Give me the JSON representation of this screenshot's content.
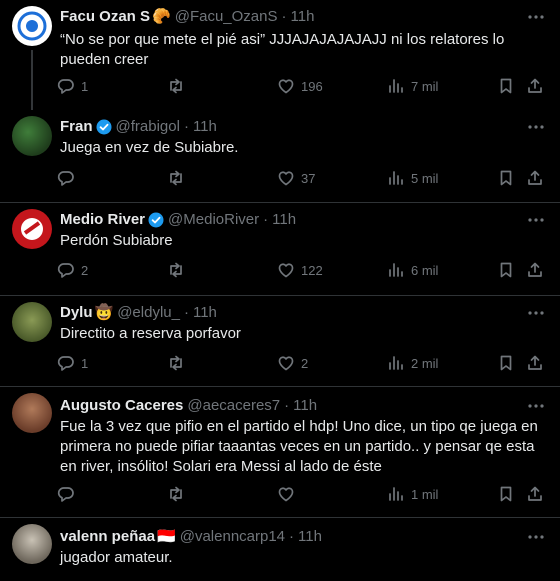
{
  "tweets": [
    {
      "name": "Facu Ozan S",
      "emoji": "🥐",
      "handle": "@Facu_OzanS",
      "time": "11h",
      "verified": false,
      "text": "“No se por que mete el pié asi” JJJAJAJAJAJAJJ ni los relatores lo pueden creer",
      "replies": "1",
      "retweets": "",
      "likes": "196",
      "views": "7 mil"
    },
    {
      "name": "Fran",
      "emoji": "",
      "handle": "@frabigol",
      "time": "11h",
      "verified": true,
      "text": "Juega en vez de Subiabre.",
      "replies": "",
      "retweets": "",
      "likes": "37",
      "views": "5 mil"
    },
    {
      "name": "Medio River",
      "emoji": "",
      "handle": "@MedioRiver",
      "time": "11h",
      "verified": true,
      "text": "Perdón Subiabre",
      "replies": "2",
      "retweets": "",
      "likes": "122",
      "views": "6 mil"
    },
    {
      "name": "Dylu",
      "emoji": "🤠",
      "handle": "@eldylu_",
      "time": "11h",
      "verified": false,
      "text": "Directito a reserva porfavor",
      "replies": "1",
      "retweets": "",
      "likes": "2",
      "views": "2 mil"
    },
    {
      "name": "Augusto Caceres",
      "emoji": "",
      "handle": "@aecaceres7",
      "time": "11h",
      "verified": false,
      "text": "Fue la 3 vez que pifio en el partido el hdp! Uno dice, un tipo qe juega en primera no puede pifiar taaantas veces en un partido.. y pensar qe esta en river, insólito! Solari era Messi al lado de éste",
      "replies": "",
      "retweets": "",
      "likes": "",
      "views": "1 mil"
    },
    {
      "name": "valenn peñaa",
      "emoji": "🇮🇩",
      "handle": "@valenncarp14",
      "time": "11h",
      "verified": false,
      "text": "jugador amateur."
    }
  ],
  "colors": {
    "background": "#000000",
    "text": "#e7e9ea",
    "muted": "#71767b",
    "divider": "#2f3336",
    "verified": "#1d9bf0"
  },
  "icons": [
    "reply-icon",
    "retweet-icon",
    "like-icon",
    "views-icon",
    "bookmark-icon",
    "share-icon",
    "more-icon",
    "verified-badge-icon"
  ]
}
